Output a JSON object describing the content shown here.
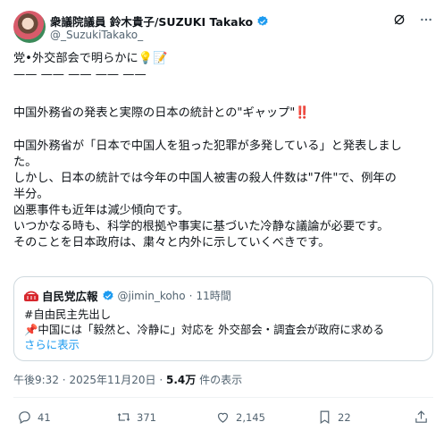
{
  "author": {
    "display_name": "衆議院議員 鈴木貴子/SUZUKI Takako",
    "handle": "@_SuzukiTakako_",
    "verified": true
  },
  "post": {
    "lines_a": [
      "党•外交部会で明らかに💡📝",
      "—— —— —— —— ——"
    ],
    "lines_b": [
      "中国外務省の発表と実際の日本の統計との\"ギャップ\"‼️"
    ],
    "lines_c": [
      "中国外務省が「日本で中国人を狙った犯罪が多発している」と発表しまし",
      "た。",
      "しかし、日本の統計では今年の中国人被害の殺人件数は\"7件\"で、例年の",
      "半分。",
      "凶悪事件も近年は減少傾向です。",
      "いつかなる時も、科学的根拠や事実に基づいた冷静な議論が必要です。",
      "そのことを日本政府は、粛々と内外に示していくべきです。"
    ]
  },
  "quote": {
    "account_name": "自民党広報",
    "handle": "@jimin_koho",
    "separator": "·",
    "time": "11時間",
    "lines": [
      "#自由民主先出し",
      "📌中国には「毅然と、冷静に」対応を 外交部会・調査会が政府に求める"
    ],
    "show_more": "さらに表示"
  },
  "meta": {
    "time": "午後9:32",
    "dot": "·",
    "date": "2025年11月20日",
    "views_count": "5.4万",
    "views_label": " 件の表示"
  },
  "actions": {
    "reply_count": "41",
    "repost_count": "371",
    "like_count": "2,145",
    "bookmark_count": "22"
  },
  "colors": {
    "accent": "#1d9bf0",
    "muted": "#536471",
    "border": "#cfd9de"
  },
  "icons": [
    "verified-badge-icon",
    "grok-icon",
    "more-icon",
    "reply-icon",
    "repost-icon",
    "like-icon",
    "bookmark-icon",
    "share-icon"
  ]
}
